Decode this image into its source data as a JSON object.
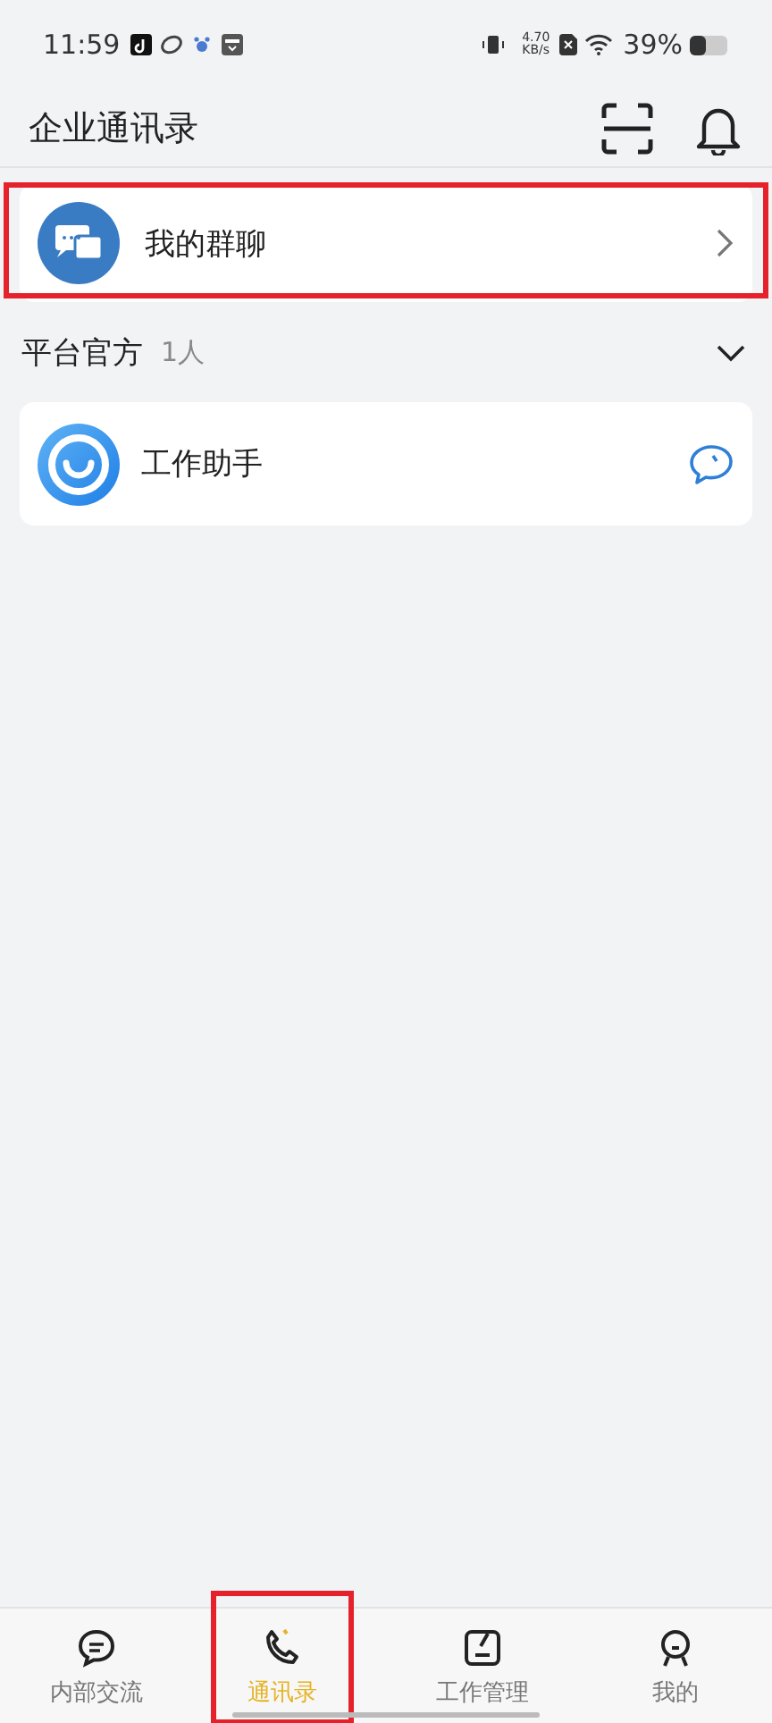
{
  "status_bar": {
    "time": "11:59",
    "net_speed": "4.70",
    "net_unit": "KB/s",
    "battery": "39%"
  },
  "header": {
    "title": "企业通讯录"
  },
  "group_chat": {
    "label": "我的群聊",
    "highlighted": true
  },
  "section": {
    "title": "平台官方",
    "count": "1人",
    "expanded": true,
    "items": [
      {
        "name": "工作助手"
      }
    ]
  },
  "tabs": [
    {
      "label": "内部交流",
      "selected": false,
      "highlighted": false
    },
    {
      "label": "通讯录",
      "selected": true,
      "highlighted": true
    },
    {
      "label": "工作管理",
      "selected": false,
      "highlighted": false
    },
    {
      "label": "我的",
      "selected": false,
      "highlighted": false
    }
  ]
}
